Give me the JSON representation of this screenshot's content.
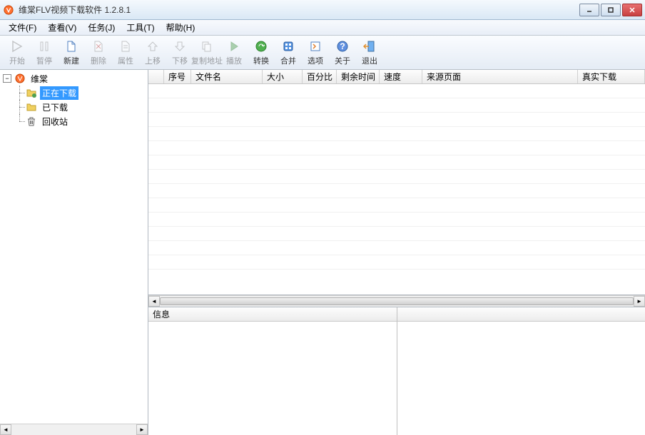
{
  "title": "维棠FLV视频下载软件 1.2.8.1",
  "menu": {
    "file": "文件(F)",
    "view": "查看(V)",
    "task": "任务(J)",
    "tools": "工具(T)",
    "help": "帮助(H)"
  },
  "toolbar": {
    "start": "开始",
    "pause": "暂停",
    "new": "新建",
    "delete": "删除",
    "properties": "属性",
    "moveup": "上移",
    "movedown": "下移",
    "copyaddr": "复制地址",
    "play": "播放",
    "convert": "转换",
    "merge": "合并",
    "options": "选项",
    "about": "关于",
    "exit": "退出"
  },
  "tree": {
    "root": "维棠",
    "downloading": "正在下载",
    "downloaded": "已下载",
    "trash": "回收站"
  },
  "columns": {
    "index": "序号",
    "filename": "文件名",
    "size": "大小",
    "percent": "百分比",
    "remaining": "剩余时间",
    "speed": "速度",
    "source": "来源页面",
    "realurl": "真实下载"
  },
  "info": {
    "label": "信息"
  }
}
